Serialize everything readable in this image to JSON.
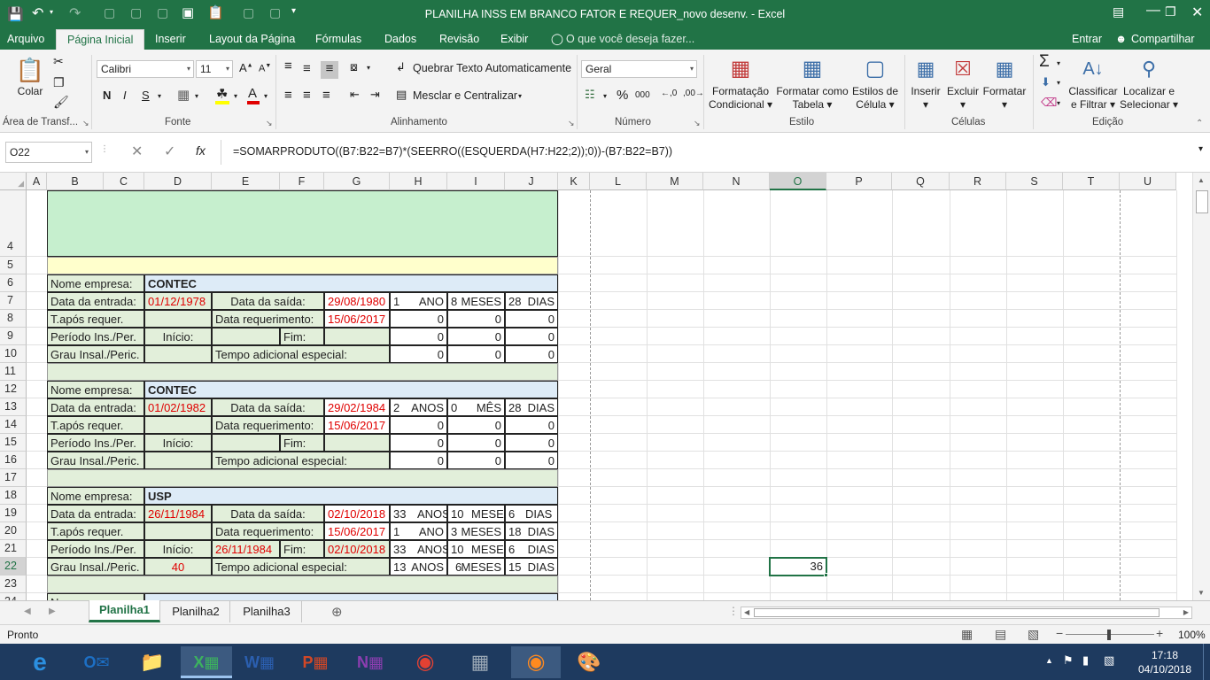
{
  "window": {
    "title": "PLANILHA INSS EM BRANCO FATOR E REQUER_novo desenv. - Excel"
  },
  "ribbon_tabs": [
    "Arquivo",
    "Página Inicial",
    "Inserir",
    "Layout da Página",
    "Fórmulas",
    "Dados",
    "Revisão",
    "Exibir"
  ],
  "tell_me": "O que você deseja fazer...",
  "sign_in": "Entrar",
  "share": "Compartilhar",
  "clipboard": {
    "paste": "Colar",
    "label": "Área de Transf..."
  },
  "font": {
    "name": "Calibri",
    "size": "11",
    "bold": "N",
    "italic": "I",
    "underline": "S",
    "label": "Fonte"
  },
  "alignment": {
    "wrap": "Quebrar Texto Automaticamente",
    "merge": "Mesclar e Centralizar",
    "label": "Alinhamento"
  },
  "number": {
    "format": "Geral",
    "label": "Número"
  },
  "styles": {
    "cond1": "Formatação",
    "cond2": "Condicional",
    "table1": "Formatar como",
    "table2": "Tabela",
    "cell1": "Estilos de",
    "cell2": "Célula",
    "label": "Estilo"
  },
  "cells": {
    "insert": "Inserir",
    "delete": "Excluir",
    "format": "Formatar",
    "label": "Células"
  },
  "editing": {
    "sort1": "Classificar",
    "sort2": "e Filtrar",
    "find1": "Localizar e",
    "find2": "Selecionar",
    "label": "Edição"
  },
  "formula_bar": {
    "name_box": "O22",
    "fx": "fx",
    "formula": "=SOMARPRODUTO((B7:B22=B7)*(SEERRO((ESQUERDA(H7:H22;2));0))-(B7:B22=B7))"
  },
  "columns": [
    "A",
    "B",
    "C",
    "D",
    "E",
    "F",
    "G",
    "H",
    "I",
    "J",
    "K",
    "L",
    "M",
    "N",
    "O",
    "P",
    "Q",
    "R",
    "S",
    "T",
    "U"
  ],
  "rows": [
    "4",
    "5",
    "6",
    "7",
    "8",
    "9",
    "10",
    "11",
    "12",
    "13",
    "14",
    "15",
    "16",
    "17",
    "18",
    "19",
    "20",
    "21",
    "22",
    "23",
    "24"
  ],
  "labels": {
    "empresa": "Nome empresa:",
    "entrada": "Data da entrada:",
    "saida": "Data da saída:",
    "treq": "T.após requer.",
    "dreq": "Data requerimento:",
    "periodo": "Período Ins./Per.",
    "inicio": "Início:",
    "fim": "Fim:",
    "grau": "Grau Insal./Peric.",
    "tadic": "Tempo adicional especial:"
  },
  "blocks": [
    {
      "empresa": "CONTEC",
      "entrada": "01/12/1978",
      "saida": "29/08/1980",
      "dreq": "15/06/2017",
      "grau": "",
      "inicio": "",
      "fim": "",
      "r7": [
        "1",
        "ANO",
        "8",
        "MESES",
        "28",
        "DIAS"
      ],
      "r8": [
        "0",
        "0",
        "0"
      ],
      "r9": [
        "0",
        "0",
        "0"
      ],
      "r10": [
        "0",
        "0",
        "0"
      ]
    },
    {
      "empresa": "CONTEC",
      "entrada": "01/02/1982",
      "saida": "29/02/1984",
      "dreq": "15/06/2017",
      "grau": "",
      "inicio": "",
      "fim": "",
      "r7": [
        "2",
        "ANOS",
        "0",
        "MÊS",
        "28",
        "DIAS"
      ],
      "r8": [
        "0",
        "0",
        "0"
      ],
      "r9": [
        "0",
        "0",
        "0"
      ],
      "r10": [
        "0",
        "0",
        "0"
      ]
    },
    {
      "empresa": "USP",
      "entrada": "26/11/1984",
      "saida": "02/10/2018",
      "dreq": "15/06/2017",
      "grau": "40",
      "inicio": "26/11/1984",
      "fim": "02/10/2018",
      "r7": [
        "33",
        "ANOS",
        "10",
        "MESES",
        "6",
        "DIAS"
      ],
      "r8": [
        "1",
        "ANO",
        "3",
        "MESES",
        "18",
        "DIAS"
      ],
      "r9": [
        "33",
        "ANOS",
        "10",
        "MESES",
        "6",
        "DIAS"
      ],
      "r10": [
        "13",
        "ANOS",
        "6",
        "MESES",
        "15",
        "DIAS"
      ]
    }
  ],
  "selected_value": "36",
  "row24_partial": "No",
  "sheets": [
    "Planilha1",
    "Planilha2",
    "Planilha3"
  ],
  "status": "Pronto",
  "zoom": "100%",
  "clock": {
    "time": "17:18",
    "date": "04/10/2018"
  }
}
